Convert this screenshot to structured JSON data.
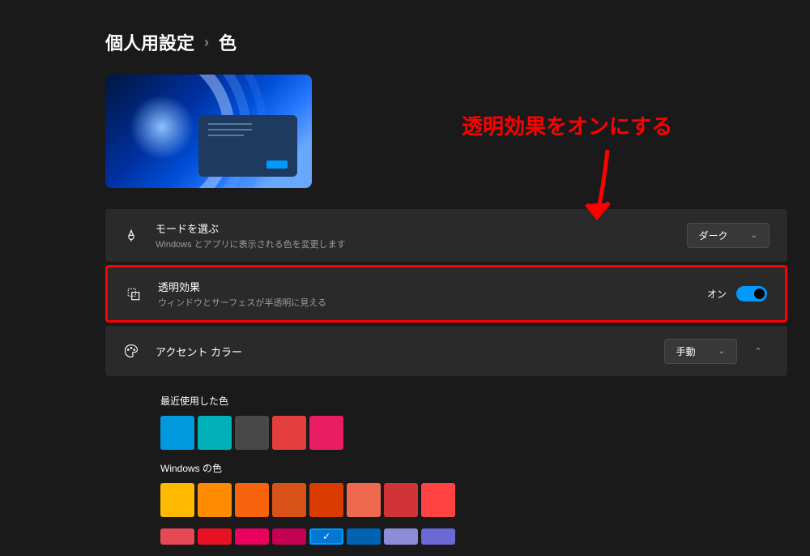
{
  "breadcrumb": {
    "parent": "個人用設定",
    "current": "色"
  },
  "annotation": {
    "text": "透明効果をオンにする"
  },
  "settings": {
    "mode": {
      "title": "モードを選ぶ",
      "desc": "Windows とアプリに表示される色を変更します",
      "value": "ダーク"
    },
    "transparency": {
      "title": "透明効果",
      "desc": "ウィンドウとサーフェスが半透明に見える",
      "state_label": "オン",
      "enabled": true
    },
    "accent": {
      "title": "アクセント カラー",
      "value": "手動"
    }
  },
  "recent_colors": {
    "label": "最近使用した色",
    "colors": [
      "#0099dd",
      "#00b0b8",
      "#484848",
      "#e53e3e",
      "#e81d62"
    ]
  },
  "windows_colors": {
    "label": "Windows の色",
    "row1": [
      "#ffb900",
      "#ff8c00",
      "#f7630c",
      "#d95319",
      "#da3b01",
      "#ef6950",
      "#d13438",
      "#ff4343"
    ],
    "row2": [
      "#e74856",
      "#e81123",
      "#ea005e",
      "#c30052",
      "#0078d4",
      "#0063b1",
      "#8e8cd8",
      "#6b69d6"
    ],
    "selected_index": 4
  }
}
